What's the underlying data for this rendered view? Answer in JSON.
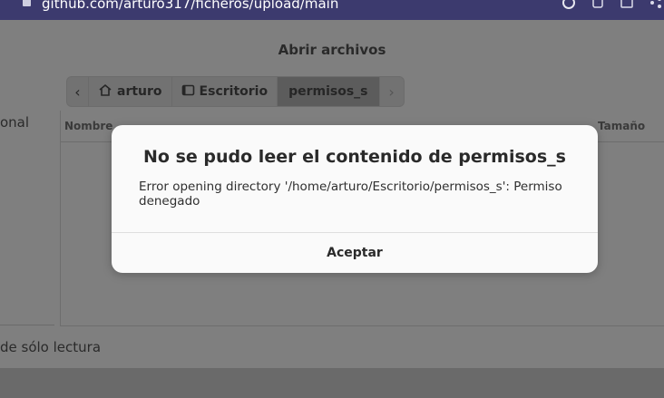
{
  "browser": {
    "url": "github.com/arturo317/ficheros/upload/main",
    "icons": [
      "google-icon",
      "install-icon",
      "translate-icon",
      "share-icon"
    ]
  },
  "dialog_window": {
    "title": "Abrir archivos",
    "sidebar_partial_label": "onal",
    "pathbar": {
      "back_glyph": "‹",
      "forward_glyph": "›",
      "items": [
        {
          "label": "arturo",
          "icon": "home-icon"
        },
        {
          "label": "Escritorio",
          "icon": "desktop-icon"
        },
        {
          "label": "permisos_s",
          "active": true
        }
      ]
    },
    "columns": {
      "name": "Nombre",
      "size": "Tamaño"
    },
    "footer_partial": "de sólo lectura"
  },
  "error_dialog": {
    "title": "No se pudo leer el contenido de permisos_s",
    "message": "Error opening directory '/home/arturo/Escritorio/permisos_s': Permiso denegado",
    "button_label": "Aceptar"
  },
  "colors": {
    "browser_bar": "#3c3a6e",
    "dimmed_window": "#7f7f7f",
    "dialog_bg": "#fafafa"
  }
}
